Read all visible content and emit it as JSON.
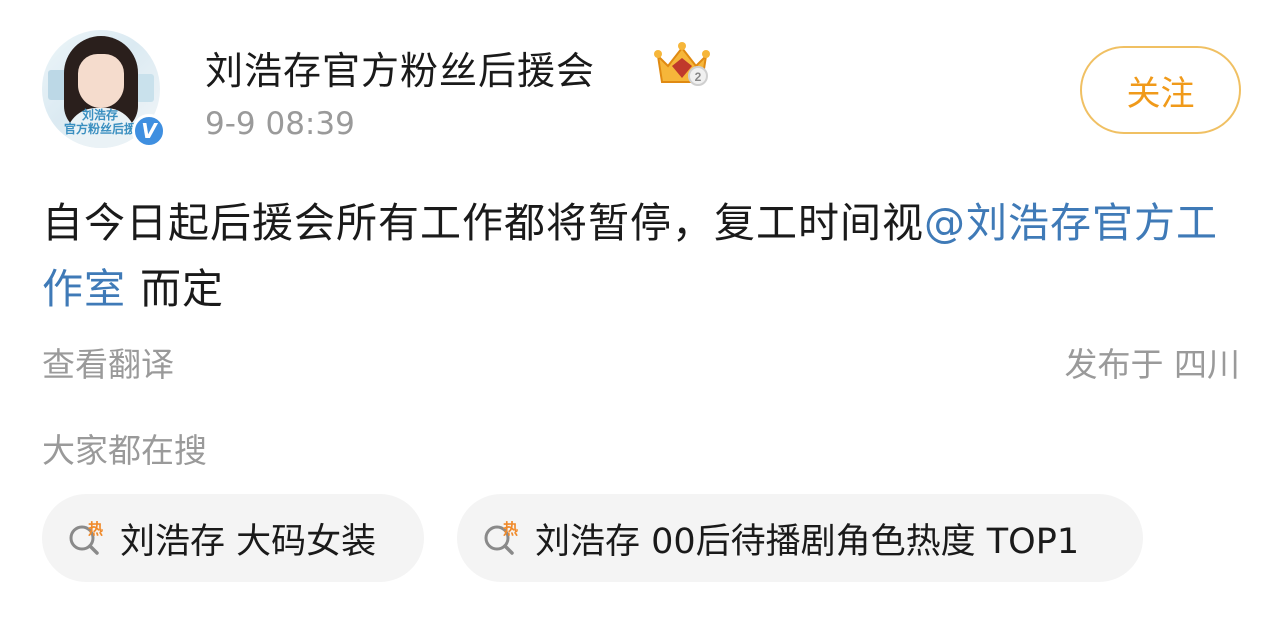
{
  "post": {
    "author": "刘浩存官方粉丝后援会",
    "avatar_caption": "刘浩存\n官方粉丝后援",
    "time": "9-9 08:39",
    "follow_label": "关注",
    "content_before": "自今日起后援会所有工作都将暂停，复工时间视",
    "mention": "@刘浩存官方工作室",
    "content_after": " 而定",
    "translate_label": "查看翻译",
    "location": "发布于 四川"
  },
  "hot_search": {
    "title": "大家都在搜",
    "hot_badge": "热",
    "items": [
      {
        "label": "刘浩存 大码女装"
      },
      {
        "label": "刘浩存 00后待播剧角色热度 TOP1"
      }
    ]
  },
  "colors": {
    "mention": "#3f7ab7",
    "follow": "#f09a1a",
    "follow_border": "#f0c063",
    "secondary_text": "#9a9a9a",
    "hot_badge": "#f08a2a",
    "verify_badge": "#3f8fe0"
  },
  "icons": {
    "crown": "crown-icon",
    "verified": "verified-badge-icon",
    "hot_search": "hot-search-icon"
  }
}
